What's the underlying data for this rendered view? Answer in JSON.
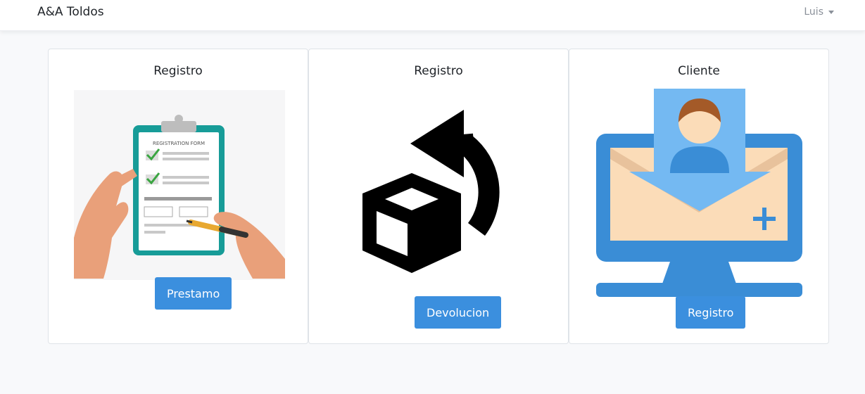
{
  "navbar": {
    "brand": "A&A Toldos",
    "user": "Luis"
  },
  "cards": [
    {
      "title": "Registro",
      "button": "Prestamo",
      "illustration": "clipboard-form-icon",
      "form_header": "REGISTRATION FORM"
    },
    {
      "title": "Registro",
      "button": "Devolucion",
      "illustration": "box-return-icon"
    },
    {
      "title": "Cliente",
      "button": "Registro",
      "illustration": "monitor-user-icon"
    }
  ],
  "colors": {
    "primary": "#3b8fde",
    "background": "#f8f9fb",
    "monitor": "#3a8dd6",
    "screen": "#fbdcb8",
    "arrow": "#74b9f2"
  }
}
